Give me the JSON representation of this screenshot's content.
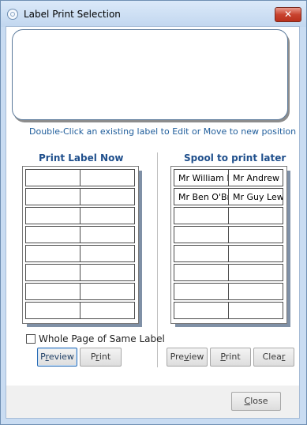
{
  "window": {
    "title": "Label Print Selection",
    "close_glyph": "✕"
  },
  "hint": "Double-Click an existing label to Edit or Move to new position",
  "print_now": {
    "title": "Print Label Now",
    "cells": [
      [
        "",
        ""
      ],
      [
        "",
        ""
      ],
      [
        "",
        ""
      ],
      [
        "",
        ""
      ],
      [
        "",
        ""
      ],
      [
        "",
        ""
      ],
      [
        "",
        ""
      ],
      [
        "",
        ""
      ]
    ]
  },
  "spool": {
    "title": "Spool to print later",
    "cells": [
      [
        "Mr William H",
        "Mr Andrew"
      ],
      [
        "Mr Ben O'Br",
        "Mr Guy Lew"
      ],
      [
        "",
        ""
      ],
      [
        "",
        ""
      ],
      [
        "",
        ""
      ],
      [
        "",
        ""
      ],
      [
        "",
        ""
      ],
      [
        "",
        ""
      ]
    ]
  },
  "whole_page": {
    "label": "Whole Page of Same Label",
    "checked": false
  },
  "buttons": {
    "preview_now": {
      "pre": "P",
      "u": "r",
      "post": "eview"
    },
    "print_now": {
      "pre": "P",
      "u": "r",
      "post": "int"
    },
    "preview_spool": {
      "pre": "Pre",
      "u": "v",
      "post": "iew"
    },
    "print_spool": {
      "pre": "",
      "u": "P",
      "post": "rint"
    },
    "clear": {
      "pre": "Clea",
      "u": "r",
      "post": ""
    },
    "close": {
      "pre": "",
      "u": "C",
      "post": "lose"
    }
  },
  "colors": {
    "accent": "#1f4f8c",
    "hint": "#1f5d9b",
    "close_button": "#c8432f"
  }
}
